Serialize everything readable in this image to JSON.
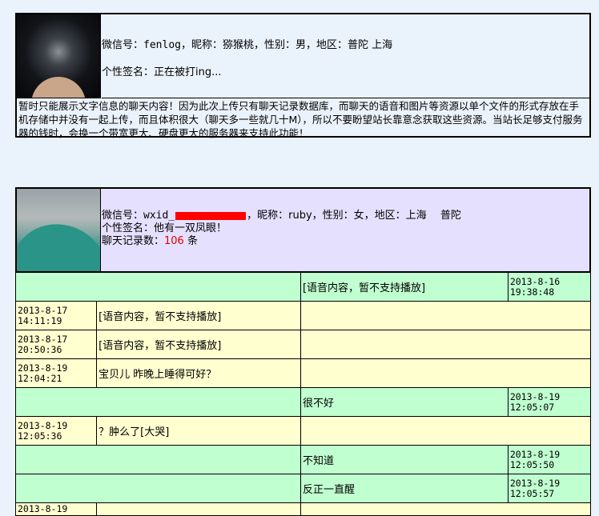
{
  "profile1": {
    "wechat_label": "微信号：",
    "wechat_id": "fenlog",
    "rest": "，昵称：猕猴桃，性别：男，地区：普陀 上海",
    "signature": "个性签名：正在被打ing..."
  },
  "notice": "暂时只能展示文字信息的聊天内容！因为此次上传只有聊天记录数据库，而聊天的语音和图片等资源以单个文件的形式存放在手机存储中并没有一起上传，而且体积很大（聊天多一些就几十M），所以不要盼望站长靠意念获取这些资源。当站长足够支付服务器的钱时，会换一个带宽更大、硬盘更大的服务器来支持此功能！",
  "profile2": {
    "wechat_label": "微信号：",
    "wechat_prefix": "wxid_",
    "rest": "，昵称：ruby，性别：女，地区：上海　 普陀",
    "signature": "个性签名：他有一双凤眼！",
    "count_label": "聊天记录数：",
    "count": "106",
    "count_unit": "条"
  },
  "messages": [
    {
      "side": "sent",
      "text": "[语音内容，暂不支持播放]",
      "date": "2013-8-16",
      "time": "19:38:48"
    },
    {
      "side": "recv",
      "text": "[语音内容，暂不支持播放]",
      "date": "2013-8-17",
      "time": "14:11:19"
    },
    {
      "side": "recv",
      "text": "[语音内容，暂不支持播放]",
      "date": "2013-8-17",
      "time": "20:50:36"
    },
    {
      "side": "recv",
      "text": "宝贝儿 昨晚上睡得可好？",
      "date": "2013-8-19",
      "time": "12:04:21"
    },
    {
      "side": "sent",
      "text": "很不好",
      "date": "2013-8-19",
      "time": "12:05:07"
    },
    {
      "side": "recv",
      "text": "？肿么了[大哭]",
      "date": "2013-8-19",
      "time": "12:05:36"
    },
    {
      "side": "sent",
      "text": "不知道",
      "date": "2013-8-19",
      "time": "12:05:50"
    },
    {
      "side": "sent",
      "text": "反正一直醒",
      "date": "2013-8-19",
      "time": "12:05:57"
    },
    {
      "side": "recv",
      "text": "",
      "date": "2013-8-19",
      "time": ""
    }
  ]
}
